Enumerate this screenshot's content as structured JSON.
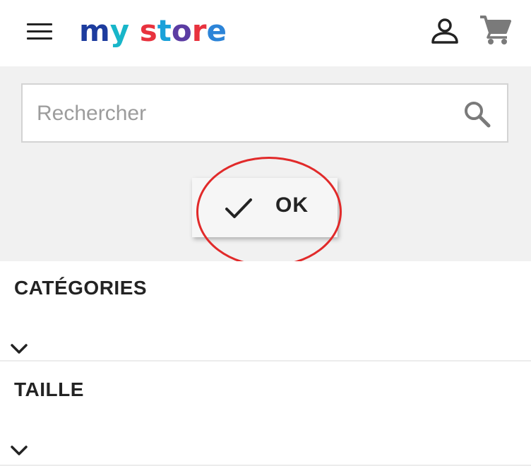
{
  "header": {
    "menu_icon": "hamburger-menu-icon",
    "logo_letters": [
      "m",
      "y",
      " ",
      "s",
      "t",
      "o",
      "r",
      "e"
    ],
    "logo_text": "my store",
    "user_icon": "user-account-icon",
    "cart_icon": "shopping-cart-icon"
  },
  "search": {
    "placeholder": "Rechercher",
    "value": "",
    "icon": "search-icon"
  },
  "filter_button": {
    "label": "OK",
    "icon": "check-icon"
  },
  "facets": [
    {
      "title": "CATÉGORIES",
      "icon": "chevron-down-icon"
    },
    {
      "title": "TAILLE",
      "icon": "chevron-down-icon"
    }
  ],
  "annotation": {
    "color": "#e12a2a"
  }
}
